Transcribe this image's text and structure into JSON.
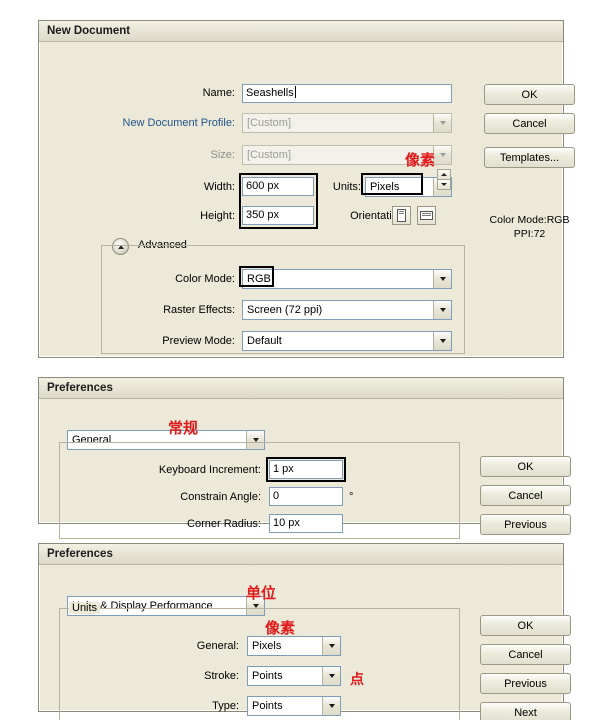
{
  "new_document": {
    "title": "New Document",
    "fields": {
      "name_label": "Name:",
      "name_value": "Seashells",
      "profile_label": "New Document Profile:",
      "profile_value": "[Custom]",
      "size_label": "Size:",
      "size_value": "[Custom]",
      "width_label": "Width:",
      "width_value": "600 px",
      "units_label": "Units:",
      "units_value": "Pixels",
      "height_label": "Height:",
      "height_value": "350 px",
      "orientation_label": "Orientation:",
      "advanced_label": "Advanced",
      "color_mode_label": "Color Mode:",
      "color_mode_value": "RGB",
      "raster_label": "Raster Effects:",
      "raster_value": "Screen (72 ppi)",
      "preview_label": "Preview Mode:",
      "preview_value": "Default"
    },
    "buttons": {
      "ok": "OK",
      "cancel": "Cancel",
      "templates": "Templates..."
    },
    "info": {
      "color_mode": "Color Mode:RGB",
      "ppi": "PPI:72"
    },
    "annotations": {
      "pixels_cn": "像素"
    }
  },
  "preferences_general": {
    "title": "Preferences",
    "category_value": "General",
    "fields": {
      "keyboard_increment_label": "Keyboard Increment:",
      "keyboard_increment_value": "1 px",
      "constrain_angle_label": "Constrain Angle:",
      "constrain_angle_value": "0",
      "degree_symbol": "°",
      "corner_radius_label": "Corner Radius:",
      "corner_radius_value": "10 px"
    },
    "buttons": {
      "ok": "OK",
      "cancel": "Cancel",
      "previous": "Previous"
    },
    "annotations": {
      "general_cn": "常规"
    }
  },
  "preferences_units": {
    "title": "Preferences",
    "category_value": "Units & Display Performance",
    "group_legend": "Units",
    "fields": {
      "general_label": "General:",
      "general_value": "Pixels",
      "stroke_label": "Stroke:",
      "stroke_value": "Points",
      "type_label": "Type:",
      "type_value": "Points"
    },
    "buttons": {
      "ok": "OK",
      "cancel": "Cancel",
      "previous": "Previous",
      "next": "Next"
    },
    "annotations": {
      "units_cn": "单位",
      "pixels_cn": "像素",
      "points_cn": "点"
    }
  }
}
